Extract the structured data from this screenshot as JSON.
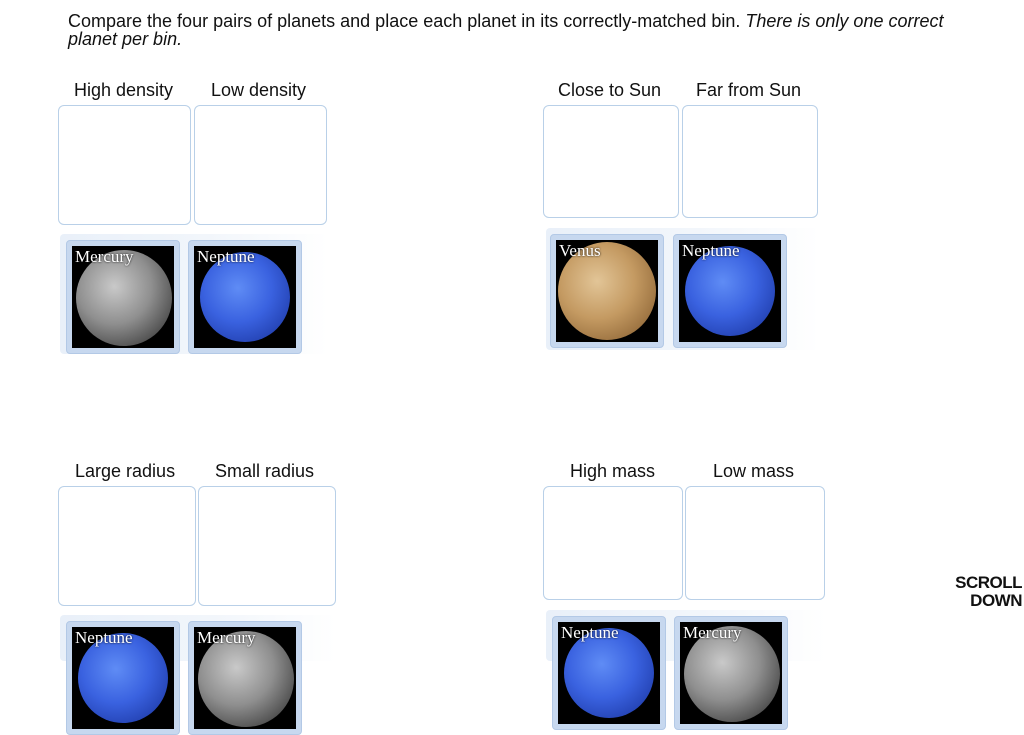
{
  "instructions": {
    "text": "Compare the four pairs of planets and place each planet in its correctly-matched bin.",
    "emphasis": "There is only one correct planet per bin."
  },
  "groups": [
    {
      "bins": [
        "High density",
        "Low density"
      ],
      "cards": [
        "Mercury",
        "Neptune"
      ]
    },
    {
      "bins": [
        "Close to Sun",
        "Far from Sun"
      ],
      "cards": [
        "Venus",
        "Neptune"
      ]
    },
    {
      "bins": [
        "Large radius",
        "Small radius"
      ],
      "cards": [
        "Neptune",
        "Mercury"
      ]
    },
    {
      "bins": [
        "High mass",
        "Low mass"
      ],
      "cards": [
        "Neptune",
        "Mercury"
      ]
    }
  ],
  "scroll_hint": {
    "line1": "SCROLL",
    "line2": "DOWN"
  }
}
